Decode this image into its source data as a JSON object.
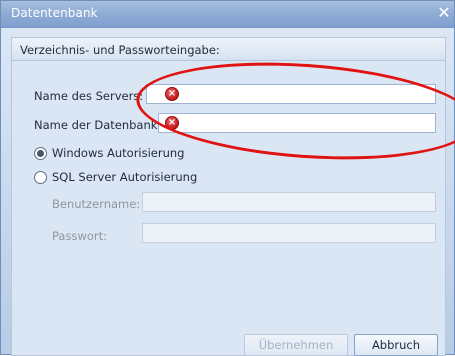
{
  "window": {
    "title": "Datentenbank",
    "close_glyph": "✕"
  },
  "group": {
    "title": "Verzeichnis- und Passworteingabe:"
  },
  "fields": {
    "server_label": "Name des Servers:",
    "server_value": "",
    "database_label": "Name der Datenbank:",
    "database_value": "",
    "error_icon": "error-icon",
    "error_color": "#c21a1a"
  },
  "auth": {
    "windows_label": "Windows Autorisierung",
    "windows_selected": true,
    "sql_label": "SQL Server Autorisierung",
    "sql_selected": false
  },
  "credentials": {
    "username_label": "Benutzername:",
    "username_value": "",
    "password_label": "Passwort:",
    "password_value": ""
  },
  "buttons": {
    "apply_label": "Übernehmen",
    "cancel_label": "Abbruch"
  },
  "annotation": {
    "shape": "ellipse",
    "color": "#e01212"
  }
}
